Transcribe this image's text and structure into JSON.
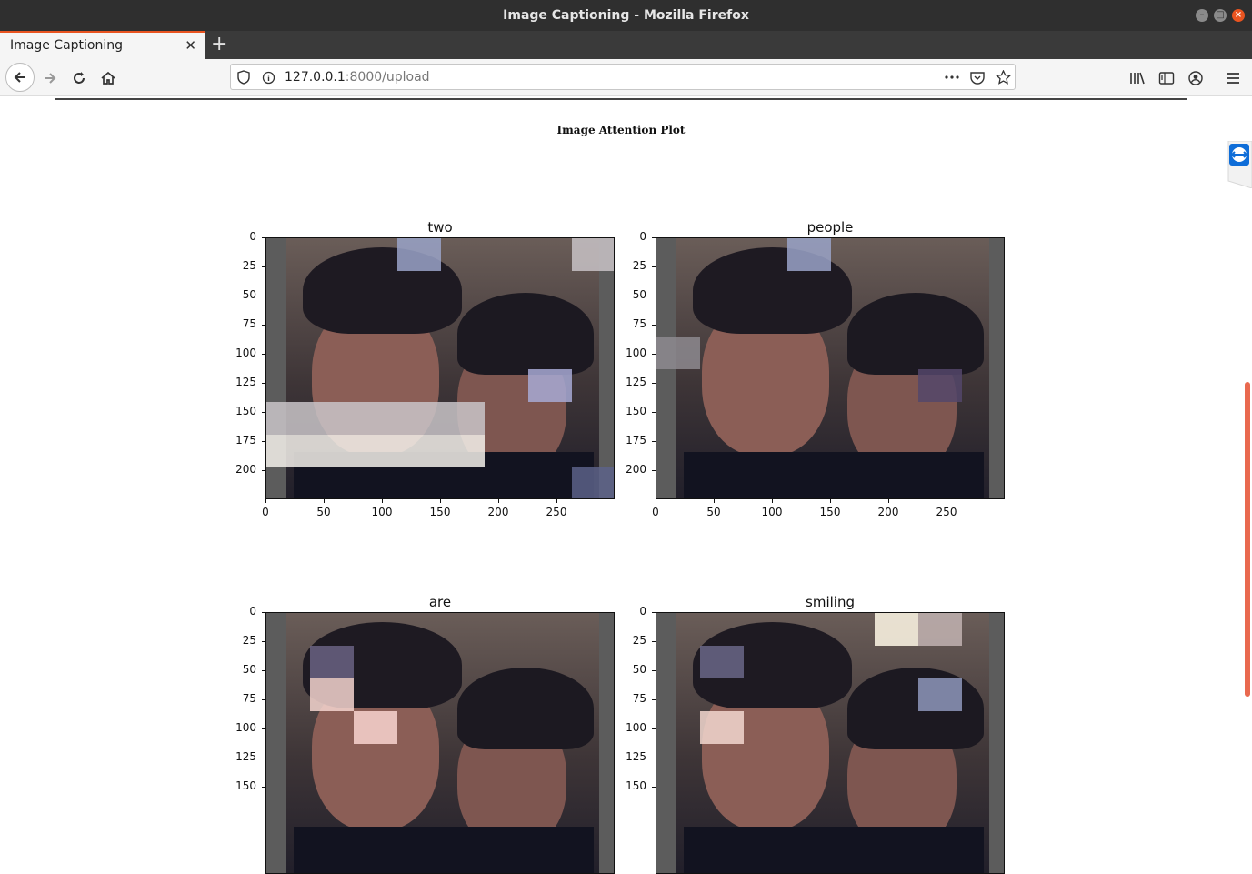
{
  "window": {
    "title": "Image Captioning - Mozilla Firefox"
  },
  "tab": {
    "title": "Image Captioning"
  },
  "address": {
    "host": "127.0.0.1",
    "rest": ":8000/upload"
  },
  "page": {
    "heading": "Image Attention Plot"
  },
  "plots": [
    {
      "word": "two",
      "yticks": [
        "0",
        "25",
        "50",
        "75",
        "100",
        "125",
        "150",
        "175",
        "200"
      ],
      "xticks": [
        "0",
        "50",
        "100",
        "150",
        "200",
        "250"
      ]
    },
    {
      "word": "people",
      "yticks": [
        "0",
        "25",
        "50",
        "75",
        "100",
        "125",
        "150",
        "175",
        "200"
      ],
      "xticks": [
        "0",
        "50",
        "100",
        "150",
        "200",
        "250"
      ]
    },
    {
      "word": "are",
      "yticks": [
        "0",
        "25",
        "50",
        "75",
        "100",
        "125",
        "150"
      ]
    },
    {
      "word": "smiling",
      "yticks": [
        "0",
        "25",
        "50",
        "75",
        "100",
        "125",
        "150"
      ]
    }
  ],
  "icons": [
    "back-arrow-icon",
    "forward-arrow-icon",
    "reload-icon",
    "home-icon",
    "shield-icon",
    "info-icon",
    "more-icon",
    "pocket-icon",
    "star-icon",
    "library-icon",
    "sidebar-icon",
    "account-icon",
    "menu-icon",
    "teamviewer-icon"
  ],
  "colors": {
    "tab_accent": "#e95420",
    "scroll_accent": "#e9694f"
  }
}
